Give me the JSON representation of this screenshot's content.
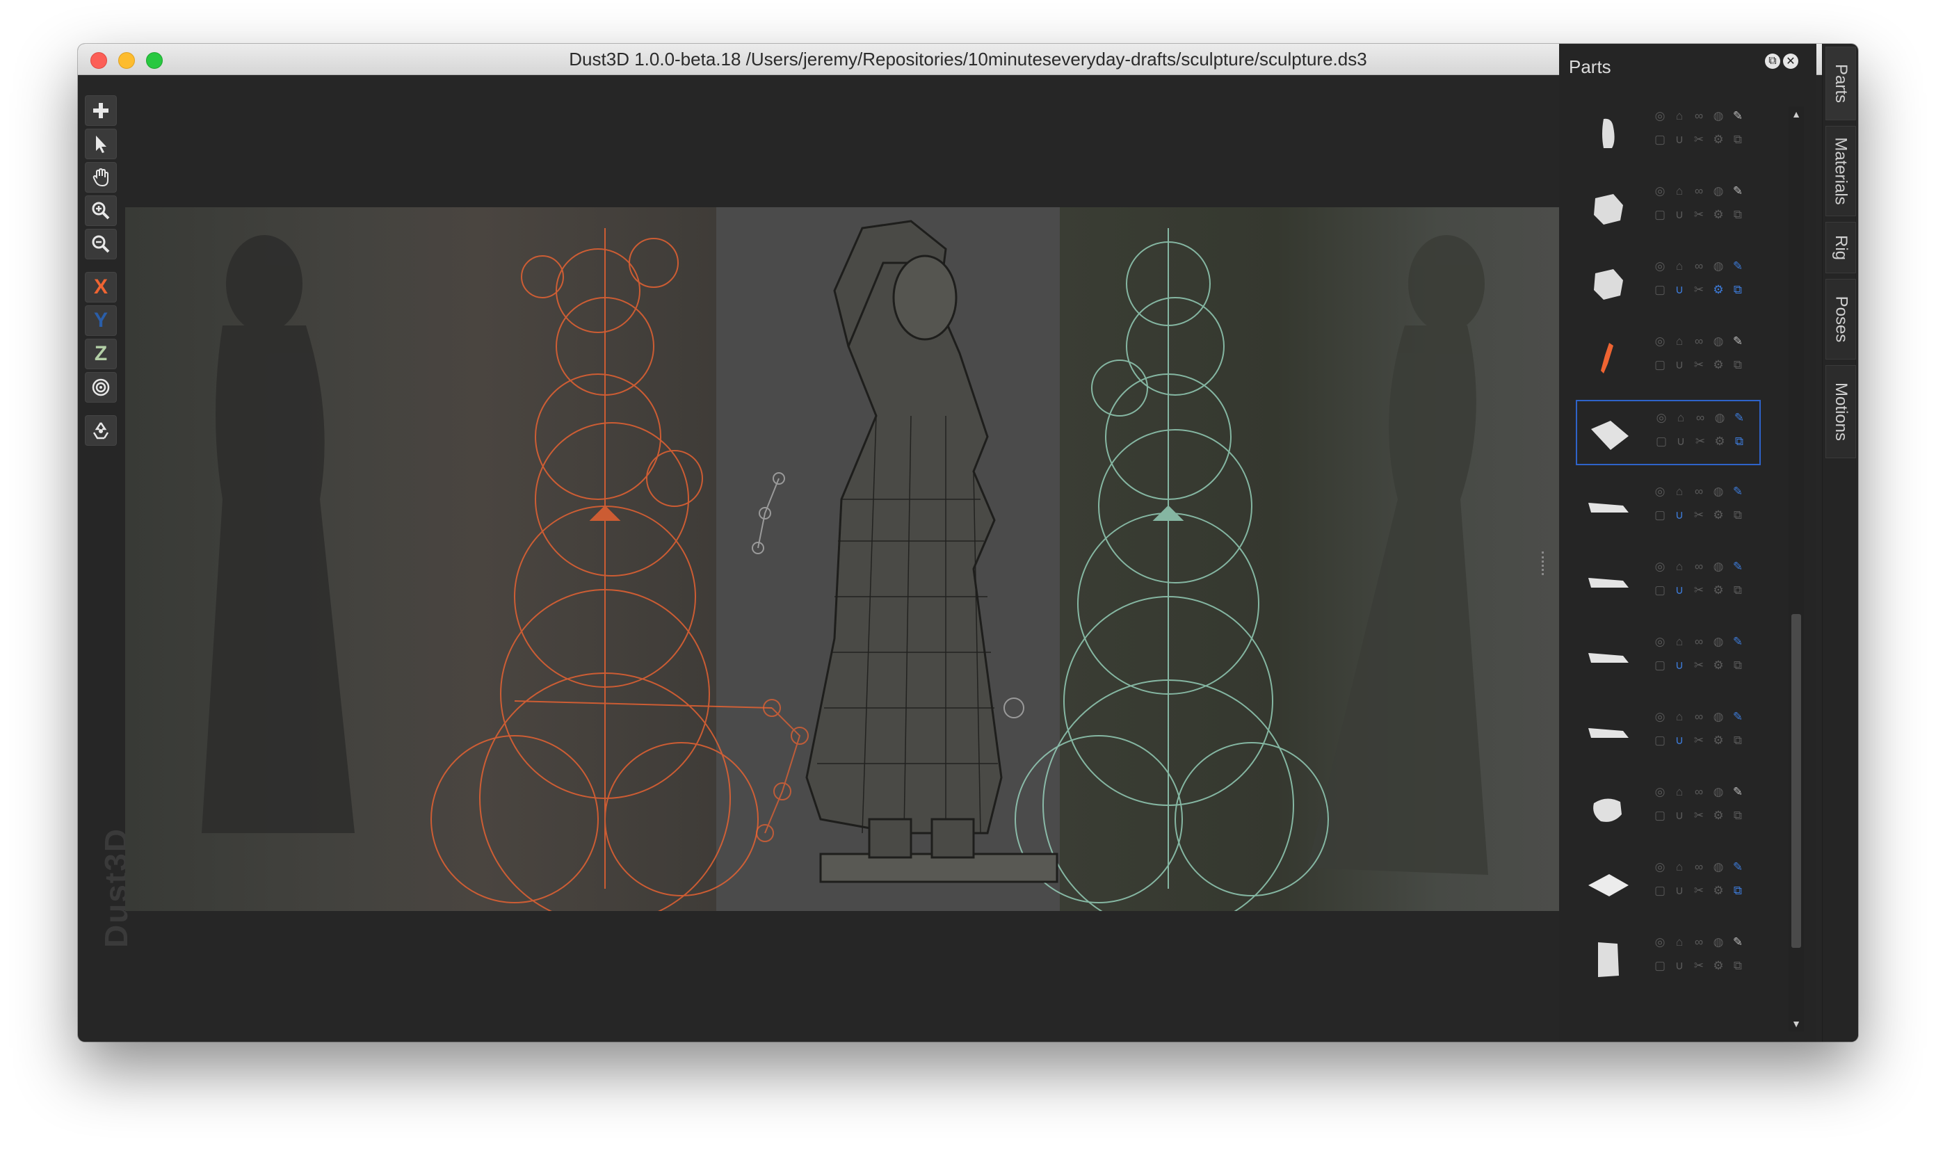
{
  "window": {
    "title": "Dust3D 1.0.0-beta.18 /Users/jeremy/Repositories/10minuteseveryday-drafts/sculpture/sculpture.ds3"
  },
  "toolbar": {
    "add_icon": "plus-icon",
    "select_icon": "pointer-icon",
    "pan_icon": "hand-icon",
    "zoom_in_icon": "zoom-in-icon",
    "zoom_out_icon": "zoom-out-icon",
    "x_label": "X",
    "y_label": "Y",
    "z_label": "Z",
    "radius_icon": "target-icon",
    "regenerate_icon": "recycle-icon"
  },
  "watermark": "Dust3D",
  "colors": {
    "accent_orange": "#ef6432",
    "accent_green": "#9fe0c8",
    "selection_blue": "#2e63c9",
    "icon_blue": "#3d7bd9",
    "axis_y": "#2a5ea9",
    "axis_z": "#b3cfa6"
  },
  "parts_panel": {
    "title": "Parts",
    "parts": [
      {
        "shape": "blob",
        "selected": false,
        "blue_icons": []
      },
      {
        "shape": "rock",
        "selected": false,
        "blue_icons": []
      },
      {
        "shape": "rock",
        "selected": false,
        "blue_icons": [
          "brush",
          "magnet",
          "gear",
          "link"
        ]
      },
      {
        "shape": "orange-sliver",
        "selected": false,
        "blue_icons": []
      },
      {
        "shape": "wedge",
        "selected": true,
        "blue_icons": [
          "brush",
          "link"
        ]
      },
      {
        "shape": "limb",
        "selected": false,
        "blue_icons": [
          "brush",
          "magnet"
        ]
      },
      {
        "shape": "limb",
        "selected": false,
        "blue_icons": [
          "brush",
          "magnet"
        ]
      },
      {
        "shape": "limb",
        "selected": false,
        "blue_icons": [
          "brush",
          "magnet"
        ]
      },
      {
        "shape": "limb",
        "selected": false,
        "blue_icons": [
          "brush",
          "magnet"
        ]
      },
      {
        "shape": "fist",
        "selected": false,
        "blue_icons": []
      },
      {
        "shape": "plane",
        "selected": false,
        "blue_icons": [
          "brush",
          "link"
        ]
      },
      {
        "shape": "box",
        "selected": false,
        "blue_icons": []
      }
    ]
  },
  "side_tabs": [
    "Parts",
    "Materials",
    "Rig",
    "Poses",
    "Motions"
  ]
}
